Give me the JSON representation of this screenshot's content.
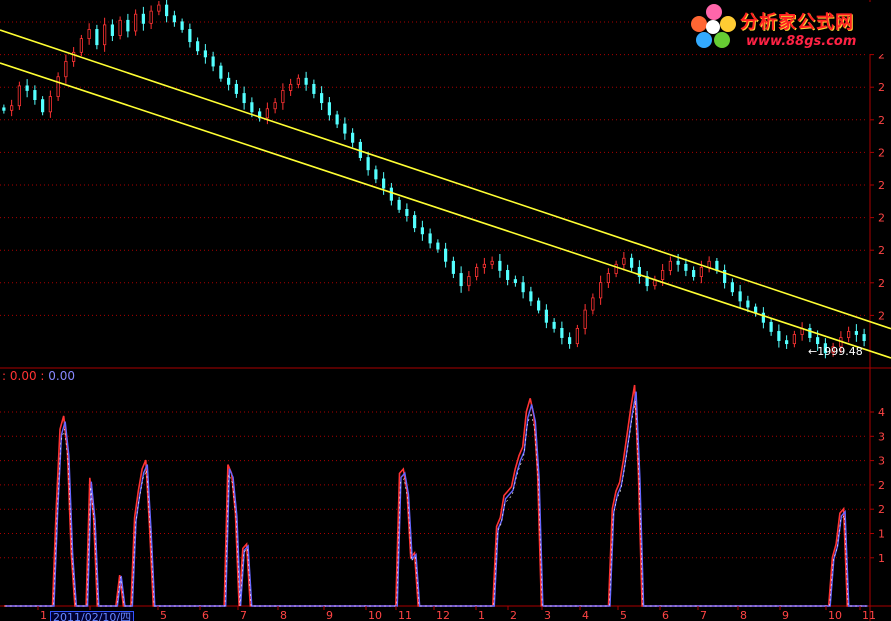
{
  "logo": {
    "text_cn": "分析家公式网",
    "url": "www.88gs.com"
  },
  "indicator": {
    "prefix": ":",
    "value1": "0.00",
    "sep": ":",
    "value2": "0.00"
  },
  "date_label": "2011/02/10/四",
  "price_marker": "←1999.48",
  "colors": {
    "background": "#000000",
    "up_candle": "#ff3333",
    "down_candle": "#55ffff",
    "channel": "#ffff33",
    "grid": "#aa0000",
    "line_red": "#ff3333",
    "line_blue": "#6666ff",
    "line_white": "#ffffff",
    "axis_text": "#ff4444"
  },
  "chart_data": [
    {
      "type": "candlestick",
      "title": "",
      "y_tick_labels": [
        "2",
        "2",
        "2",
        "2",
        "2",
        "2",
        "2",
        "2",
        "2",
        "2"
      ],
      "channel_lines": [
        {
          "from": {
            "x": 0,
            "price": 3058
          },
          "to": {
            "x": 1,
            "price": 2079
          }
        },
        {
          "from": {
            "x": 0,
            "price": 2950
          },
          "to": {
            "x": 1,
            "price": 1983
          }
        }
      ],
      "close_series": [
        2795,
        2810,
        2875,
        2860,
        2830,
        2790,
        2840,
        2905,
        2955,
        2985,
        3030,
        3060,
        3010,
        3075,
        3040,
        3090,
        3055,
        3110,
        3080,
        3120,
        3140,
        3105,
        3085,
        3060,
        3020,
        2990,
        2970,
        2940,
        2900,
        2880,
        2850,
        2820,
        2790,
        2770,
        2800,
        2820,
        2860,
        2880,
        2900,
        2880,
        2850,
        2820,
        2780,
        2750,
        2720,
        2690,
        2640,
        2600,
        2570,
        2540,
        2500,
        2470,
        2450,
        2410,
        2390,
        2360,
        2340,
        2300,
        2260,
        2220,
        2250,
        2280,
        2290,
        2300,
        2270,
        2240,
        2230,
        2200,
        2170,
        2140,
        2100,
        2080,
        2050,
        2030,
        2080,
        2140,
        2180,
        2230,
        2260,
        2290,
        2310,
        2280,
        2250,
        2220,
        2240,
        2270,
        2300,
        2290,
        2270,
        2250,
        2280,
        2300,
        2270,
        2230,
        2200,
        2170,
        2150,
        2130,
        2100,
        2070,
        2040,
        2030,
        2060,
        2080,
        2050,
        2030,
        2000,
        2020,
        2050,
        2070,
        2060,
        2040
      ],
      "last_label": "←1999.48"
    },
    {
      "type": "line",
      "title": "",
      "y_tick_labels": [
        "4",
        "3",
        "3",
        "2",
        "2",
        "1",
        "1"
      ],
      "x_tick_labels": [
        "1",
        "2011/02/10/四",
        "5",
        "6",
        "7",
        "8",
        "9",
        "10",
        "11",
        "12",
        "1",
        "2",
        "3",
        "4",
        "5",
        "6",
        "7",
        "8",
        "9",
        "10",
        "11"
      ],
      "ylim": [
        0,
        5
      ],
      "series": [
        {
          "values": [
            0,
            0,
            0,
            0,
            0,
            0,
            0,
            0,
            0,
            0,
            0,
            0,
            0,
            0,
            2.2,
            4.0,
            4.3,
            3.5,
            1.2,
            0,
            0,
            0,
            0,
            2.9,
            2.0,
            0,
            0,
            0,
            0,
            0,
            0,
            0.7,
            0,
            0,
            0,
            2.0,
            2.6,
            3.1,
            3.3,
            1.8,
            0,
            0,
            0,
            0,
            0,
            0,
            0,
            0,
            0,
            0,
            0,
            0,
            0,
            0,
            0,
            0,
            0,
            0,
            0,
            0,
            3.2,
            3.0,
            2.1,
            0,
            1.3,
            1.4,
            0,
            0,
            0,
            0,
            0,
            0,
            0,
            0,
            0,
            0,
            0,
            0,
            0,
            0,
            0,
            0,
            0,
            0,
            0,
            0,
            0,
            0,
            0,
            0,
            0,
            0,
            0,
            0,
            0,
            0,
            0,
            0,
            0,
            0,
            0,
            0,
            0,
            0,
            0,
            0,
            3.0,
            3.1,
            2.6,
            1.1,
            1.2,
            0,
            0,
            0,
            0,
            0,
            0,
            0,
            0,
            0,
            0,
            0,
            0,
            0,
            0,
            0,
            0,
            0,
            0,
            0,
            0,
            0,
            1.8,
            2.0,
            2.5,
            2.6,
            2.7,
            3.1,
            3.4,
            3.6,
            4.4,
            4.7,
            4.3,
            3.0,
            0,
            0,
            0,
            0,
            0,
            0,
            0,
            0,
            0,
            0,
            0,
            0,
            0,
            0,
            0,
            0,
            0,
            0,
            0,
            2.2,
            2.6,
            2.8,
            3.3,
            3.9,
            4.5,
            5.0,
            3.0,
            0,
            0,
            0,
            0,
            0,
            0,
            0,
            0,
            0,
            0,
            0,
            0,
            0,
            0,
            0,
            0,
            0,
            0,
            0,
            0,
            0,
            0,
            0,
            0,
            0,
            0,
            0,
            0,
            0,
            0,
            0,
            0,
            0,
            0,
            0,
            0,
            0,
            0,
            0,
            0,
            0,
            0,
            0,
            0,
            0,
            0,
            0,
            0,
            0,
            0,
            0,
            1.1,
            1.4,
            2.1,
            2.2,
            0,
            0,
            0,
            0,
            0,
            0
          ]
        }
      ]
    }
  ]
}
